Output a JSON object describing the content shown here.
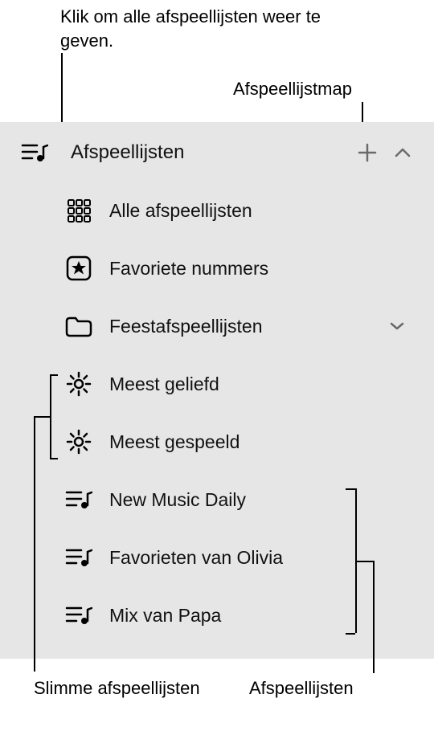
{
  "callouts": {
    "click_all": "Klik om alle afspeellijsten weer te geven.",
    "folder": "Afspeellijstmap",
    "smart": "Slimme afspeellijsten",
    "playlists": "Afspeellijsten"
  },
  "header": {
    "title": "Afspeellijsten"
  },
  "items": {
    "all": "Alle afspeellijsten",
    "favorites": "Favoriete nummers",
    "party": "Feestafspeellijsten",
    "loved": "Meest geliefd",
    "played": "Meest gespeeld",
    "new_daily": "New Music Daily",
    "olivia": "Favorieten van Olivia",
    "papa": "Mix van Papa"
  }
}
